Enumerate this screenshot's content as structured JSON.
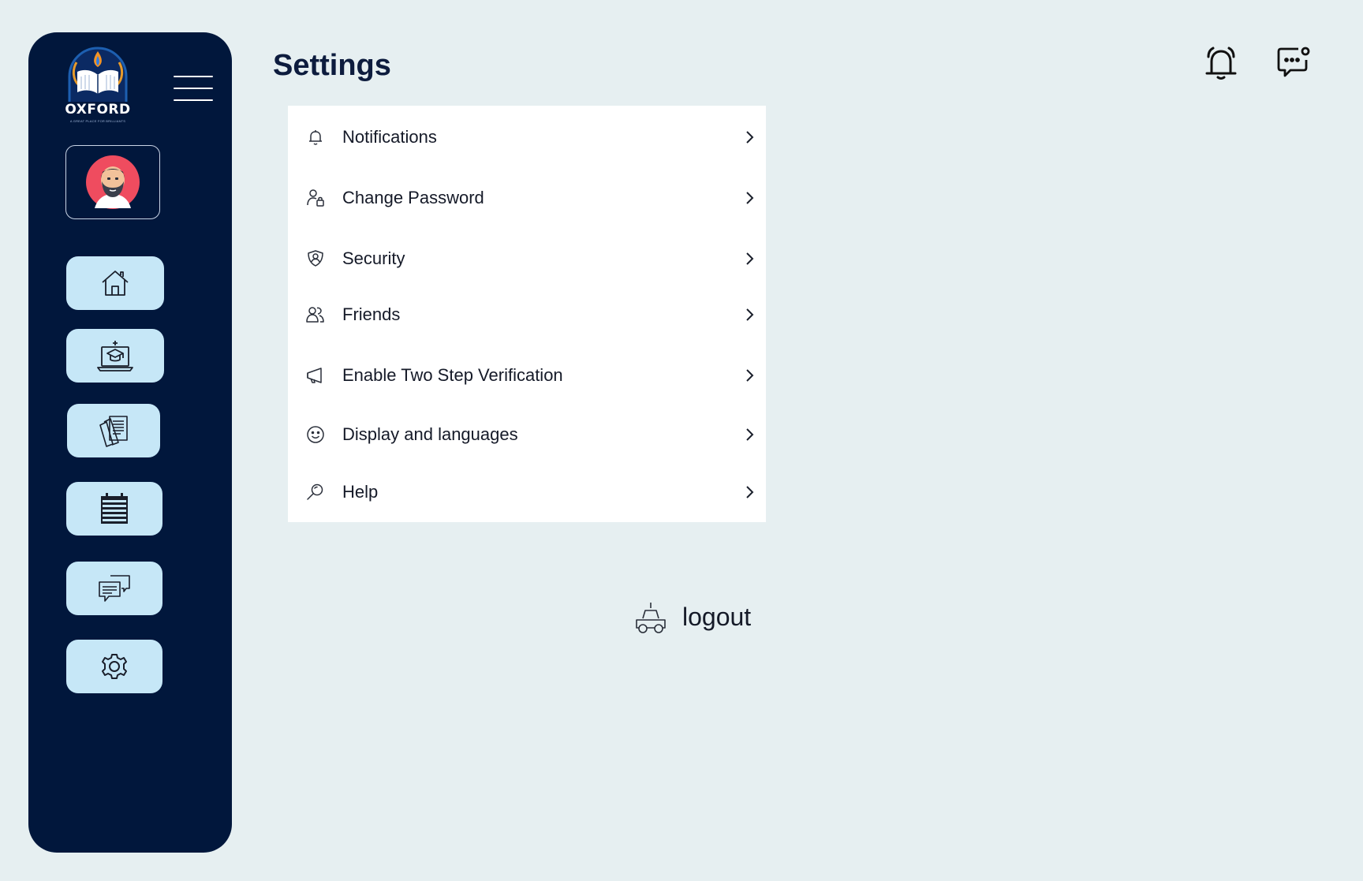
{
  "brand": {
    "name": "OXFORD",
    "tagline": "A GREAT PLACE FOR BRILLIANTS"
  },
  "page": {
    "title": "Settings"
  },
  "sidebar": {
    "nav": [
      {
        "icon": "home-icon"
      },
      {
        "icon": "laptop-graduation-icon"
      },
      {
        "icon": "documents-icon"
      },
      {
        "icon": "calendar-icon"
      },
      {
        "icon": "chat-icon"
      },
      {
        "icon": "gear-icon"
      }
    ]
  },
  "settings": {
    "items": [
      {
        "label": "Notifications",
        "icon": "bell-icon"
      },
      {
        "label": "Change Password",
        "icon": "user-lock-icon"
      },
      {
        "label": "Security",
        "icon": "shield-user-icon"
      },
      {
        "label": "Friends",
        "icon": "users-icon"
      },
      {
        "label": "Enable Two Step Verification",
        "icon": "megaphone-icon"
      },
      {
        "label": "Display and languages",
        "icon": "smiley-icon"
      },
      {
        "label": "Help",
        "icon": "search-icon"
      }
    ]
  },
  "logout": {
    "label": "logout",
    "icon": "car-icon"
  },
  "colors": {
    "background": "#e6eff1",
    "sidebar": "#01173c",
    "nav_button": "#c6e7f7",
    "panel": "#ffffff",
    "title": "#0d1c3e",
    "avatar_bg": "#ef4c5f"
  }
}
